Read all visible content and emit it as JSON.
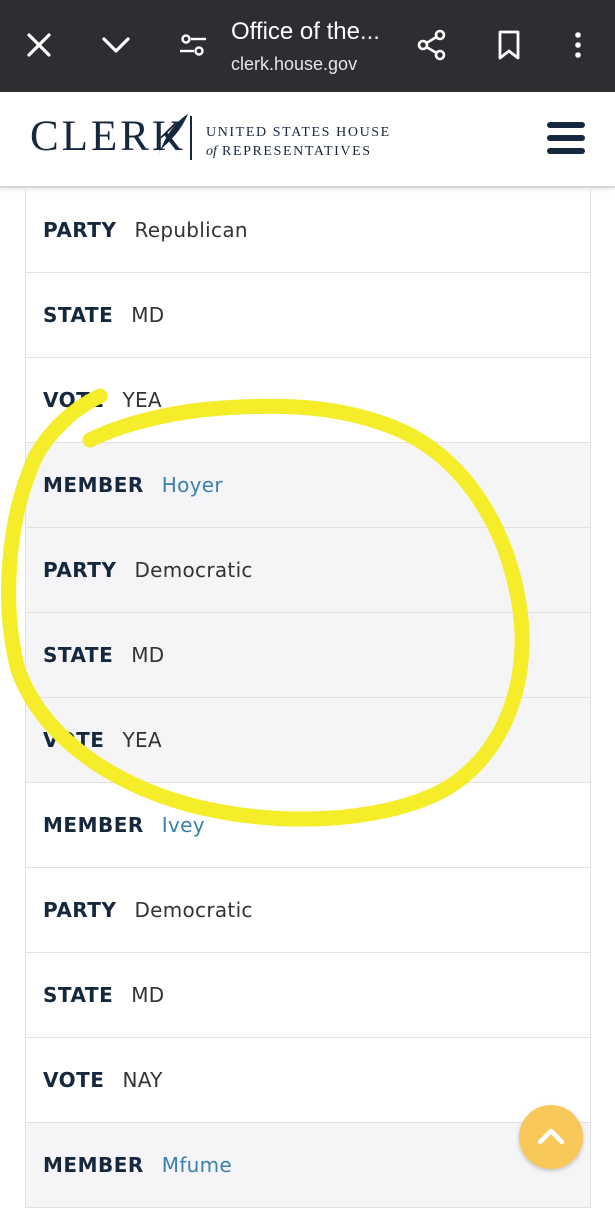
{
  "browser": {
    "title": "Office of the...",
    "url": "clerk.house.gov",
    "icons": [
      "close-icon",
      "chevron-down-icon",
      "tune-icon",
      "share-icon",
      "bookmark-icon",
      "more-vert-icon"
    ]
  },
  "header": {
    "logo_word": "CLERK",
    "logo_line1": "UNITED STATES HOUSE",
    "logo_line2_of": "of",
    "logo_line2_rest": "REPRESENTATIVES",
    "menu_icon": "hamburger-icon"
  },
  "rows": [
    {
      "label": "PARTY",
      "value": "Republican",
      "shaded": false,
      "link": false
    },
    {
      "label": "STATE",
      "value": "MD",
      "shaded": false,
      "link": false
    },
    {
      "label": "VOTE",
      "value": "YEA",
      "shaded": false,
      "link": false
    },
    {
      "label": "MEMBER",
      "value": "Hoyer",
      "shaded": true,
      "link": true
    },
    {
      "label": "PARTY",
      "value": "Democratic",
      "shaded": true,
      "link": false
    },
    {
      "label": "STATE",
      "value": "MD",
      "shaded": true,
      "link": false
    },
    {
      "label": "VOTE",
      "value": "YEA",
      "shaded": true,
      "link": false
    },
    {
      "label": "MEMBER",
      "value": "Ivey",
      "shaded": false,
      "link": true
    },
    {
      "label": "PARTY",
      "value": "Democratic",
      "shaded": false,
      "link": false
    },
    {
      "label": "STATE",
      "value": "MD",
      "shaded": false,
      "link": false
    },
    {
      "label": "VOTE",
      "value": "NAY",
      "shaded": false,
      "link": false
    },
    {
      "label": "MEMBER",
      "value": "Mfume",
      "shaded": true,
      "link": true
    }
  ],
  "annotation": {
    "color": "#f5ec2a"
  },
  "back_to_top": {
    "icon": "chevron-up-icon",
    "color": "#f9c85b"
  },
  "colors": {
    "navy": "#16283d",
    "link": "#3a7fae",
    "shaded_row": "#f5f5f7"
  }
}
